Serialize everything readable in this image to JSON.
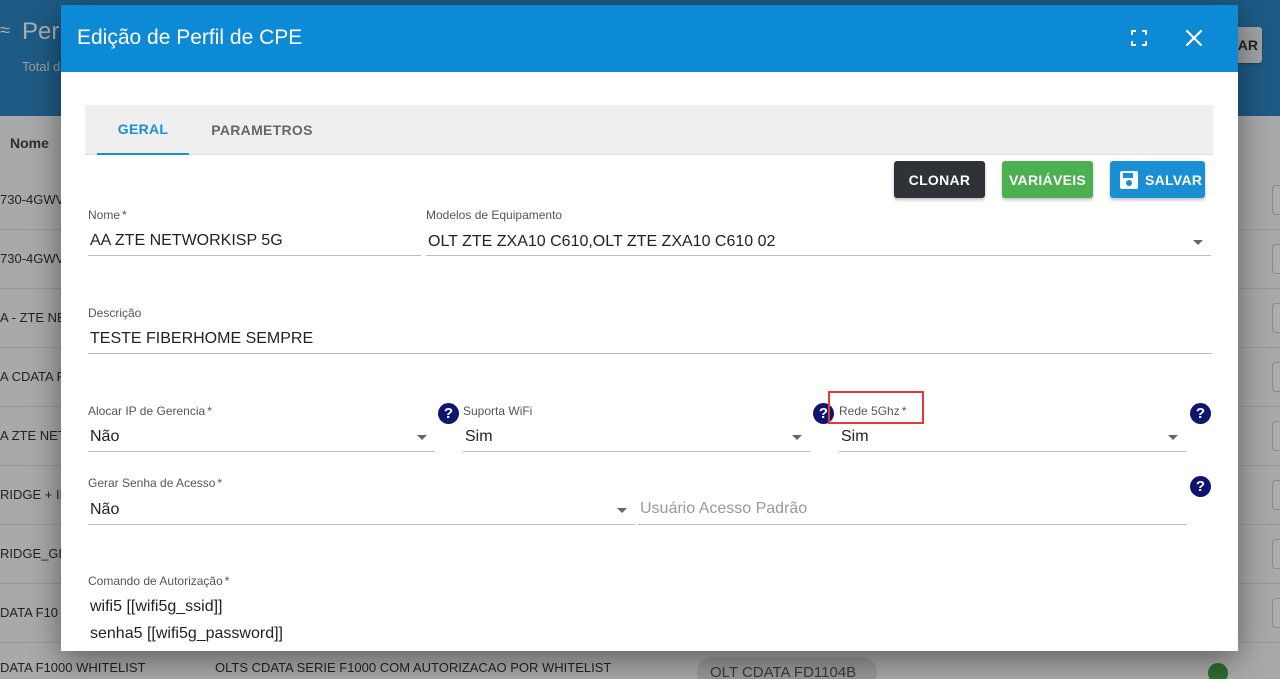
{
  "background": {
    "title": "Per",
    "subtitle": "Total d",
    "action_label": "AR",
    "column_header": "Nome",
    "rows": [
      "730-4GWV",
      "730-4GWV",
      "A - ZTE NE",
      "A CDATA F",
      "A ZTE NET",
      "RIDGE + IF",
      "RIDGE_GP",
      "DATA F10"
    ],
    "last_row": {
      "name": "DATA F1000 WHITELIST",
      "description": "OLTS CDATA SERIE F1000 COM AUTORIZACAO POR WHITELIST",
      "chip": "OLT CDATA FD1104B"
    }
  },
  "dialog": {
    "title": "Edição de Perfil de CPE",
    "tabs": [
      "GERAL",
      "PARAMETROS"
    ],
    "buttons": {
      "clonar": "CLONAR",
      "variaveis": "VARIÁVEIS",
      "salvar": "SALVAR"
    },
    "fields": {
      "nome": {
        "label": "Nome",
        "required": "*",
        "value": "AA ZTE NETWORKISP 5G"
      },
      "modelos": {
        "label": "Modelos de Equipamento",
        "value": "OLT ZTE ZXA10 C610,OLT ZTE ZXA10 C610 02"
      },
      "descricao": {
        "label": "Descrição",
        "value": "TESTE FIBERHOME SEMPRE"
      },
      "alocar_ip": {
        "label": "Alocar IP de Gerencia",
        "required": "*",
        "value": "Não"
      },
      "suporta_wifi": {
        "label": "Suporta WiFi",
        "value": "Sim"
      },
      "rede_5ghz": {
        "label": "Rede 5Ghz",
        "required": "*",
        "value": "Sim"
      },
      "gerar_senha": {
        "label": "Gerar Senha de Acesso",
        "required": "*",
        "value": "Não"
      },
      "usuario_acesso": {
        "placeholder": "Usuário Acesso Padrão"
      },
      "comando": {
        "label": "Comando de Autorização",
        "required": "*",
        "lines": [
          "wifi5 [[wifi5g_ssid]]",
          "senha5 [[wifi5g_password]]"
        ]
      }
    },
    "help_symbol": "?"
  },
  "colors": {
    "header": "#0c8ad6",
    "accent": "#1a8fd3",
    "success": "#4caf50",
    "dark": "#2f3237",
    "help": "#0d1570",
    "highlight": "#e53935"
  },
  "icons": [
    "wifi-icon",
    "expand-icon",
    "close-icon",
    "save-icon",
    "help-icon",
    "chevron-down-icon",
    "check-icon"
  ]
}
